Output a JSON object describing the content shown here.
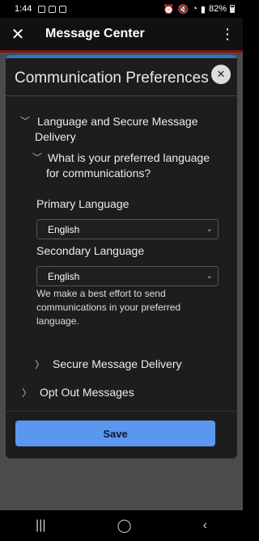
{
  "status": {
    "time": "1:44",
    "battery": "82%"
  },
  "app_bar": {
    "title": "Message Center"
  },
  "modal": {
    "title": "Communication Preferences",
    "section_language": {
      "line1": "Language and Secure Message",
      "line2": "Delivery"
    },
    "question": {
      "line1": "What is your preferred language",
      "line2": "for communications?"
    },
    "primary": {
      "label": "Primary Language",
      "value": "English"
    },
    "secondary": {
      "label": "Secondary Language",
      "value": "English"
    },
    "note": "We make a best effort to send communications in your preferred language.",
    "secure_delivery": "Secure Message Delivery",
    "opt_out": "Opt Out Messages",
    "save": "Save"
  },
  "colors": {
    "accent": "#5b97ef",
    "modal_bg": "#1d1d1d",
    "app_bg": "#111111"
  }
}
